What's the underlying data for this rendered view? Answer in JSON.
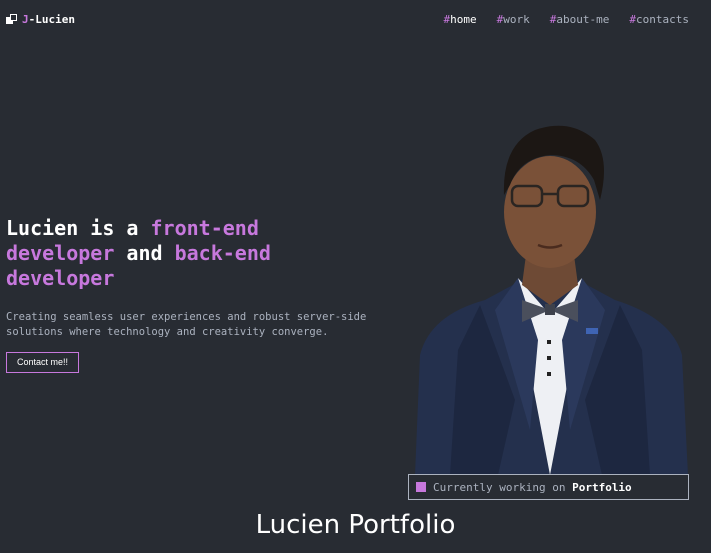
{
  "nav": {
    "logo": {
      "prefix": "J",
      "name": "-Lucien"
    },
    "links": [
      {
        "hash": "#",
        "label": "home"
      },
      {
        "hash": "#",
        "label": "work"
      },
      {
        "hash": "#",
        "label": "about-me"
      },
      {
        "hash": "#",
        "label": "contacts"
      }
    ]
  },
  "hero": {
    "title_parts": [
      "Lucien is a ",
      "front-end",
      " developer",
      " and ",
      "back-end",
      " developer"
    ],
    "description": "Creating seamless user experiences and robust server-side solutions where technology and creativity converge.",
    "cta_label": "Contact me!!"
  },
  "status": {
    "prefix": "Currently working on ",
    "project": "Portfolio"
  },
  "footer": {
    "title": "Lucien Portfolio"
  },
  "colors": {
    "background": "#282c33",
    "accent": "#c778dd",
    "text": "#abb2bf",
    "white": "#ffffff"
  },
  "icons": {
    "logo": "logo-icon",
    "status": "square-icon"
  }
}
